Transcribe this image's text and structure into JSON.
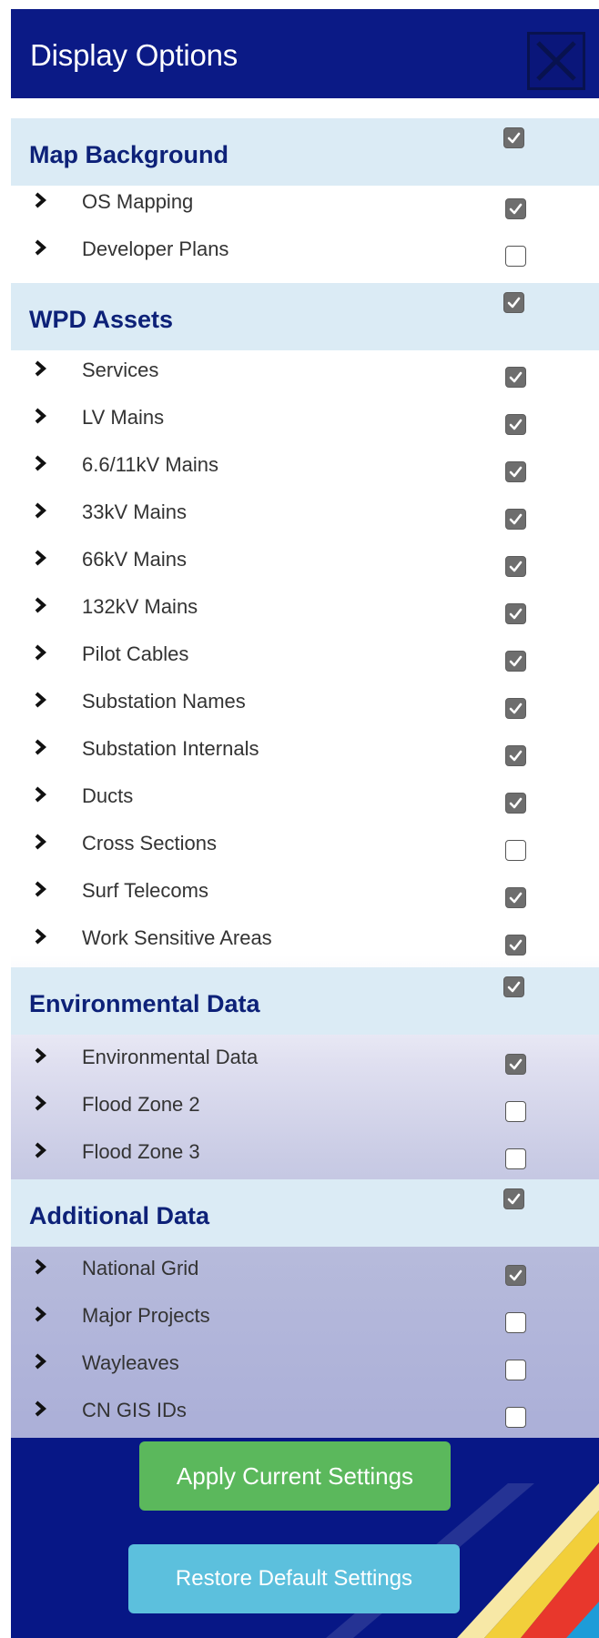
{
  "header": {
    "title": "Display Options",
    "close_icon": "close-x-icon"
  },
  "sections": [
    {
      "title": "Map Background",
      "checked": true,
      "items": [
        {
          "label": "OS Mapping",
          "checked": true
        },
        {
          "label": "Developer Plans",
          "checked": false
        }
      ]
    },
    {
      "title": "WPD Assets",
      "checked": true,
      "items": [
        {
          "label": "Services",
          "checked": true
        },
        {
          "label": "LV Mains",
          "checked": true
        },
        {
          "label": "6.6/11kV Mains",
          "checked": true
        },
        {
          "label": "33kV Mains",
          "checked": true
        },
        {
          "label": "66kV Mains",
          "checked": true
        },
        {
          "label": "132kV Mains",
          "checked": true
        },
        {
          "label": "Pilot Cables",
          "checked": true
        },
        {
          "label": "Substation Names",
          "checked": true
        },
        {
          "label": "Substation Internals",
          "checked": true
        },
        {
          "label": "Ducts",
          "checked": true
        },
        {
          "label": "Cross Sections",
          "checked": false
        },
        {
          "label": "Surf Telecoms",
          "checked": true
        },
        {
          "label": "Work Sensitive Areas",
          "checked": true
        }
      ]
    },
    {
      "title": "Environmental Data",
      "checked": true,
      "items": [
        {
          "label": "Environmental Data",
          "checked": true
        },
        {
          "label": "Flood Zone 2",
          "checked": false
        },
        {
          "label": "Flood Zone 3",
          "checked": false
        }
      ]
    },
    {
      "title": "Additional Data",
      "checked": true,
      "items": [
        {
          "label": "National Grid",
          "checked": true
        },
        {
          "label": "Major Projects",
          "checked": false
        },
        {
          "label": "Wayleaves",
          "checked": false
        },
        {
          "label": "CN GIS IDs",
          "checked": false
        }
      ]
    }
  ],
  "buttons": {
    "apply": "Apply Current Settings",
    "restore": "Restore Default Settings"
  },
  "colors": {
    "header_bg": "#0b1a86",
    "section_bg": "#dbebf5",
    "section_title": "#0d2178",
    "apply_button": "#5bb85c",
    "restore_button": "#5cc0dd",
    "footer_bg": "#071786"
  }
}
